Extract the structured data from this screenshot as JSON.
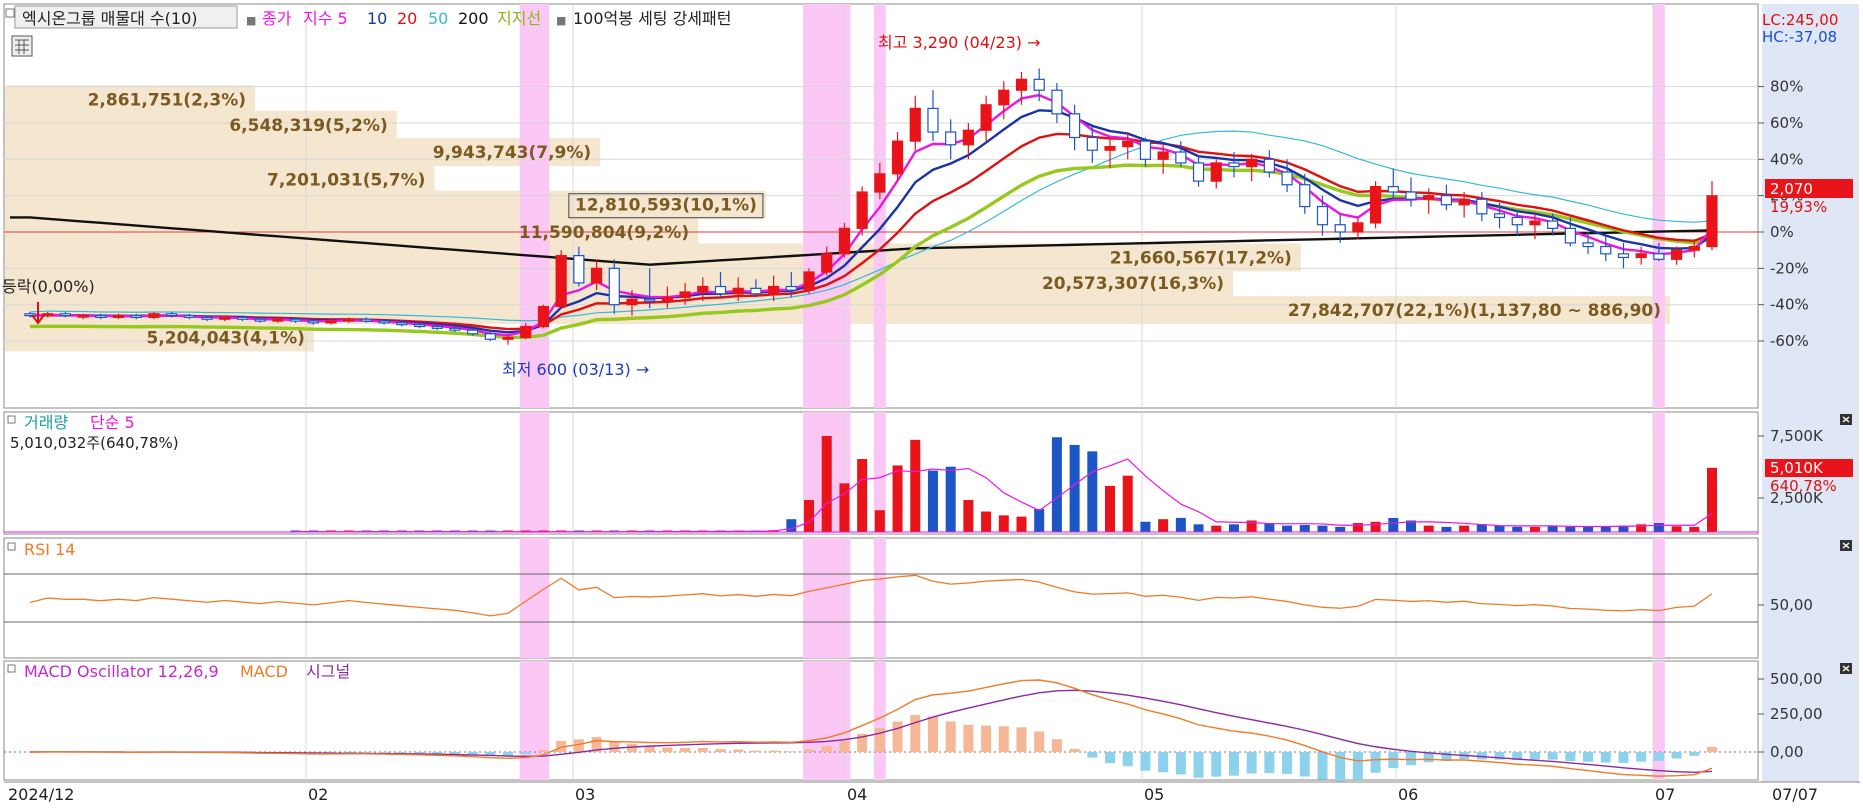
{
  "colors": {
    "up": "#e8141a",
    "down": "#1c55c6",
    "highlight": "#fbc8f5",
    "profile": "#f5e6d0",
    "ma5": "#ec16e4",
    "ma10": "#1a34a8",
    "ma20": "#e01010",
    "ma50": "#36b8d8",
    "ma200": "#111111",
    "support": "#96c81e",
    "axisBg": "#dfe6f5",
    "rsi": "#f07a28",
    "macd": "#f07a28",
    "signal": "#8a2aa0",
    "osc": "#8cd2ec",
    "oscPos": "#f5b896"
  },
  "legend": {
    "marker": "■",
    "indicator": "엑시온그룹 매물대 수(10)",
    "close": "종가",
    "ma": "지수 5",
    "ma10": "10",
    "ma20": "20",
    "ma50": "50",
    "ma200": "200",
    "support": "지지선",
    "pattern": "100억봉 세팅 강세패턴"
  },
  "right_labels": {
    "lc": "LC:245,00",
    "hc": "HC:-37,08",
    "price": "2,070",
    "price_change": "19,93%"
  },
  "annotations": {
    "high": "최고 3,290 (04/23) →",
    "low": "최저 600 (03/13) →",
    "flat": "등락(0,00%)"
  },
  "volume_panel": {
    "title": "거래량",
    "ma": "단순 5",
    "info": "5,010,032주(640,78%)",
    "current": "5,010K",
    "current_pct": "640,78%"
  },
  "rsi_panel": {
    "title": "RSI 14"
  },
  "macd_panel": {
    "title": "MACD Oscillator 12,26,9",
    "macd": "MACD",
    "signal": "시그널"
  },
  "chart_data": {
    "type": "candlestick",
    "y_axis_price": {
      "scale": "percent change",
      "ticks": [
        "80%",
        "60%",
        "40%",
        "20%",
        "0%",
        "-20%",
        "-40%",
        "-60%"
      ],
      "values": [
        80,
        60,
        40,
        20,
        0,
        -20,
        -40,
        -60
      ],
      "range": [
        -80,
        90
      ]
    },
    "x_axis": {
      "labels": [
        "2024/12",
        "02",
        "03",
        "04",
        "05",
        "06",
        "07"
      ],
      "end_label": "07/07"
    },
    "volume_profile": [
      {
        "label": "2,861,751(2,3%)",
        "price_pct": 73,
        "share": 2.3
      },
      {
        "label": "6,548,319(5,2%)",
        "price_pct": 59,
        "share": 5.2
      },
      {
        "label": "9,943,743(7,9%)",
        "price_pct": 44,
        "share": 7.9
      },
      {
        "label": "7,201,031(5,7%)",
        "price_pct": 29,
        "share": 5.7
      },
      {
        "label": "12,810,593(10,1%)",
        "price_pct": 15,
        "share": 10.1
      },
      {
        "label": "11,590,804(9,2%)",
        "price_pct": 0,
        "share": 9.2
      },
      {
        "label": "21,660,567(17,2%)",
        "price_pct": -14,
        "share": 17.2
      },
      {
        "label": "20,573,307(16,3%)",
        "price_pct": -28,
        "share": 16.3
      },
      {
        "label": "27,842,707(22,1%)(1,137,80 ~ 886,90)",
        "price_pct": -43,
        "share": 22.1
      },
      {
        "label": "5,204,043(4,1%)",
        "price_pct": -58,
        "share": 4.1
      }
    ],
    "ohlc_pct": [
      [
        -45,
        -44,
        -47,
        -46
      ],
      [
        -46,
        -44,
        -47,
        -45
      ],
      [
        -45,
        -44,
        -47,
        -46
      ],
      [
        -46,
        -45,
        -48,
        -46
      ],
      [
        -46,
        -45,
        -48,
        -47
      ],
      [
        -47,
        -45,
        -48,
        -46
      ],
      [
        -46,
        -45,
        -48,
        -47
      ],
      [
        -47,
        -44,
        -48,
        -45
      ],
      [
        -45,
        -44,
        -47,
        -46
      ],
      [
        -46,
        -45,
        -48,
        -47
      ],
      [
        -47,
        -46,
        -49,
        -48
      ],
      [
        -48,
        -46,
        -49,
        -47
      ],
      [
        -47,
        -46,
        -49,
        -48
      ],
      [
        -48,
        -47,
        -50,
        -49
      ],
      [
        -49,
        -47,
        -50,
        -48
      ],
      [
        -48,
        -47,
        -50,
        -49
      ],
      [
        -49,
        -48,
        -51,
        -50
      ],
      [
        -50,
        -48,
        -51,
        -49
      ],
      [
        -49,
        -47,
        -50,
        -48
      ],
      [
        -48,
        -47,
        -50,
        -49
      ],
      [
        -49,
        -48,
        -51,
        -50
      ],
      [
        -50,
        -49,
        -52,
        -51
      ],
      [
        -51,
        -50,
        -53,
        -52
      ],
      [
        -52,
        -51,
        -54,
        -53
      ],
      [
        -53,
        -52,
        -55,
        -54
      ],
      [
        -54,
        -53,
        -57,
        -56
      ],
      [
        -56,
        -55,
        -60,
        -59
      ],
      [
        -59,
        -57,
        -62,
        -58
      ],
      [
        -58,
        -50,
        -59,
        -52
      ],
      [
        -52,
        -40,
        -53,
        -41
      ],
      [
        -41,
        -10,
        -42,
        -13
      ],
      [
        -13,
        -8,
        -30,
        -28
      ],
      [
        -28,
        -15,
        -32,
        -20
      ],
      [
        -20,
        -15,
        -45,
        -40
      ],
      [
        -40,
        -32,
        -46,
        -37
      ],
      [
        -37,
        -20,
        -42,
        -38
      ],
      [
        -38,
        -30,
        -42,
        -36
      ],
      [
        -36,
        -28,
        -40,
        -33
      ],
      [
        -33,
        -25,
        -38,
        -30
      ],
      [
        -30,
        -22,
        -36,
        -34
      ],
      [
        -34,
        -25,
        -38,
        -31
      ],
      [
        -31,
        -26,
        -36,
        -34
      ],
      [
        -34,
        -24,
        -38,
        -30
      ],
      [
        -30,
        -22,
        -36,
        -32
      ],
      [
        -32,
        -20,
        -34,
        -22
      ],
      [
        -22,
        -8,
        -24,
        -12
      ],
      [
        -12,
        5,
        -14,
        2
      ],
      [
        2,
        25,
        -2,
        22
      ],
      [
        22,
        38,
        18,
        32
      ],
      [
        32,
        55,
        28,
        50
      ],
      [
        50,
        75,
        45,
        68
      ],
      [
        68,
        78,
        50,
        55
      ],
      [
        55,
        62,
        40,
        48
      ],
      [
        48,
        60,
        40,
        56
      ],
      [
        56,
        75,
        50,
        70
      ],
      [
        70,
        83,
        62,
        78
      ],
      [
        78,
        88,
        70,
        84
      ],
      [
        84,
        90,
        72,
        78
      ],
      [
        78,
        82,
        60,
        65
      ],
      [
        65,
        70,
        45,
        52
      ],
      [
        52,
        58,
        38,
        45
      ],
      [
        45,
        52,
        35,
        47
      ],
      [
        47,
        55,
        40,
        50
      ],
      [
        50,
        52,
        36,
        40
      ],
      [
        40,
        48,
        32,
        44
      ],
      [
        44,
        50,
        36,
        38
      ],
      [
        38,
        42,
        25,
        28
      ],
      [
        28,
        40,
        24,
        38
      ],
      [
        38,
        44,
        30,
        36
      ],
      [
        36,
        43,
        28,
        40
      ],
      [
        40,
        45,
        30,
        33
      ],
      [
        33,
        40,
        22,
        26
      ],
      [
        26,
        32,
        10,
        14
      ],
      [
        14,
        20,
        -2,
        4
      ],
      [
        4,
        10,
        -6,
        0
      ],
      [
        0,
        8,
        -4,
        5
      ],
      [
        5,
        28,
        2,
        25
      ],
      [
        25,
        35,
        18,
        22
      ],
      [
        22,
        30,
        14,
        18
      ],
      [
        18,
        24,
        10,
        20
      ],
      [
        20,
        26,
        12,
        15
      ],
      [
        15,
        22,
        8,
        18
      ],
      [
        18,
        22,
        6,
        10
      ],
      [
        10,
        16,
        2,
        8
      ],
      [
        8,
        12,
        -2,
        4
      ],
      [
        4,
        10,
        -4,
        6
      ],
      [
        6,
        10,
        -2,
        2
      ],
      [
        2,
        8,
        -8,
        -6
      ],
      [
        -6,
        0,
        -12,
        -8
      ],
      [
        -8,
        -2,
        -16,
        -12
      ],
      [
        -12,
        -6,
        -20,
        -14
      ],
      [
        -14,
        -8,
        -18,
        -12
      ],
      [
        -12,
        -6,
        -16,
        -15
      ],
      [
        -15,
        -8,
        -18,
        -10
      ],
      [
        -10,
        -4,
        -14,
        -8
      ],
      [
        -8,
        28,
        -10,
        19.93
      ]
    ],
    "volume_k": [
      30,
      25,
      20,
      30,
      35,
      25,
      20,
      30,
      25,
      20,
      30,
      25,
      20,
      25,
      30,
      25,
      30,
      20,
      25,
      30,
      40,
      35,
      45,
      40,
      50,
      60,
      80,
      140,
      1000,
      2500,
      7500,
      3800,
      5700,
      1700,
      5200,
      7200,
      4800,
      5100,
      2500,
      1600,
      1300,
      1200,
      1800,
      7400,
      6800,
      6300,
      3600,
      4400,
      800,
      1000,
      1100,
      600,
      500,
      600,
      900,
      700,
      500,
      550,
      500,
      400,
      700,
      800,
      1100,
      900,
      500,
      400,
      500,
      600,
      500,
      400,
      400,
      500,
      400,
      450,
      400,
      500,
      600,
      700,
      450,
      400,
      5010
    ],
    "rsi_range": [
      0,
      100
    ],
    "rsi_ticks": [
      "50,00"
    ],
    "macd_ticks": [
      "500,00",
      "250,00",
      "0,00"
    ],
    "volume_ticks": [
      "7,500K",
      "2,500K"
    ]
  }
}
